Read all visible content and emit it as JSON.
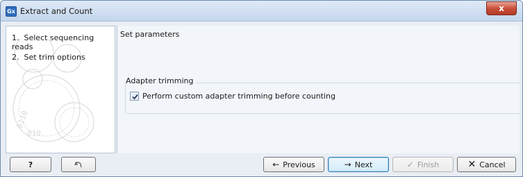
{
  "window": {
    "title": "Extract and Count",
    "app_icon_text": "Gx",
    "close_glyph": "x",
    "accent_color": "#2f6fc0"
  },
  "steps": [
    {
      "number": "1.",
      "label": "Select sequencing reads"
    },
    {
      "number": "2.",
      "label": "Set trim options"
    }
  ],
  "main": {
    "section_title": "Set parameters",
    "group_title": "Adapter trimming",
    "checkbox_label": "Perform custom adapter trimming before counting",
    "checkbox_checked": true
  },
  "footer": {
    "help_label": "?",
    "previous_label": "Previous",
    "next_label": "Next",
    "finish_label": "Finish",
    "cancel_label": "Cancel",
    "finish_enabled": false
  },
  "icons": {
    "previous": "arrow-left-icon",
    "next": "arrow-right-icon",
    "finish": "checkmark-icon",
    "cancel": "x-icon",
    "reset": "undo-icon"
  }
}
